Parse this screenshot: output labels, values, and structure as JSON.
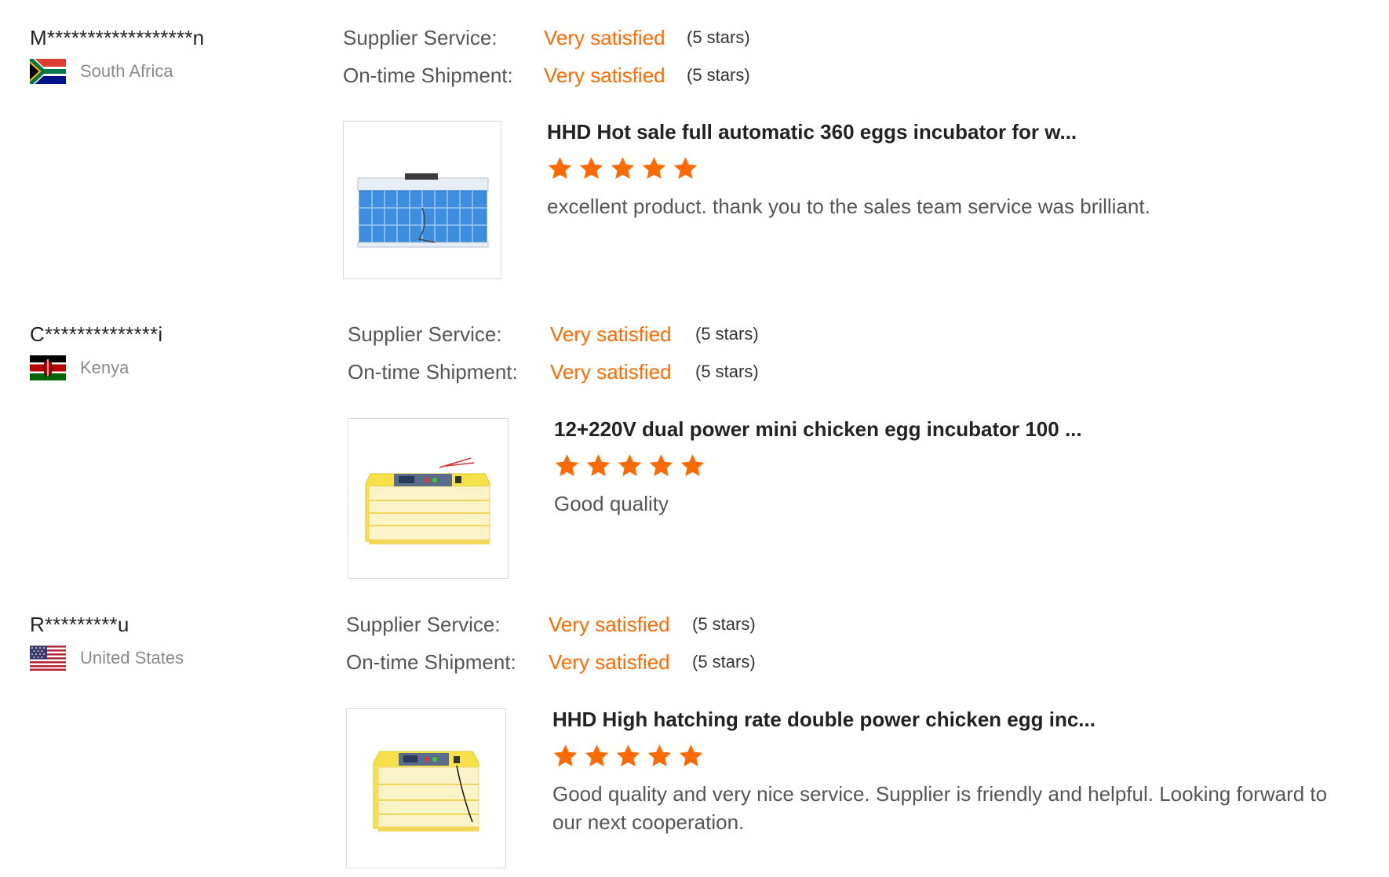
{
  "reviews": [
    {
      "buyer": "M******************n",
      "country": "South Africa",
      "flag_icon": "south-africa-flag-icon",
      "supplier_service_label": "Supplier Service:",
      "supplier_service_value": "Very satisfied",
      "supplier_service_stars": "(5 stars)",
      "shipment_label": "On-time Shipment:",
      "shipment_value": "Very satisfied",
      "shipment_stars": "(5 stars)",
      "product_title": "HHD Hot sale full automatic 360 eggs incubator for w...",
      "product_image": "blue-incubator-product-image",
      "rating": 5,
      "text": "excellent product. thank you to the sales team service was brilliant."
    },
    {
      "buyer": "C**************i",
      "country": "Kenya",
      "flag_icon": "kenya-flag-icon",
      "supplier_service_label": "Supplier Service:",
      "supplier_service_value": "Very satisfied",
      "supplier_service_stars": "(5 stars)",
      "shipment_label": "On-time Shipment:",
      "shipment_value": "Very satisfied",
      "shipment_stars": "(5 stars)",
      "product_title": "12+220V dual power mini chicken egg incubator 100 ...",
      "product_image": "yellow-incubator-product-image",
      "rating": 5,
      "text": "Good quality"
    },
    {
      "buyer": "R*********u",
      "country": "United States",
      "flag_icon": "united-states-flag-icon",
      "supplier_service_label": "Supplier Service:",
      "supplier_service_value": "Very satisfied",
      "supplier_service_stars": "(5 stars)",
      "shipment_label": "On-time Shipment:",
      "shipment_value": "Very satisfied",
      "shipment_stars": "(5 stars)",
      "product_title": "HHD High hatching rate double power chicken egg inc...",
      "product_image": "yellow-incubator-product-image",
      "rating": 5,
      "text": "Good quality and very nice service. Supplier is friendly and helpful. Looking forward to our next cooperation."
    }
  ],
  "colors": {
    "accent": "#ff6a00",
    "label": "#555555",
    "muted": "#8a8a8a"
  }
}
